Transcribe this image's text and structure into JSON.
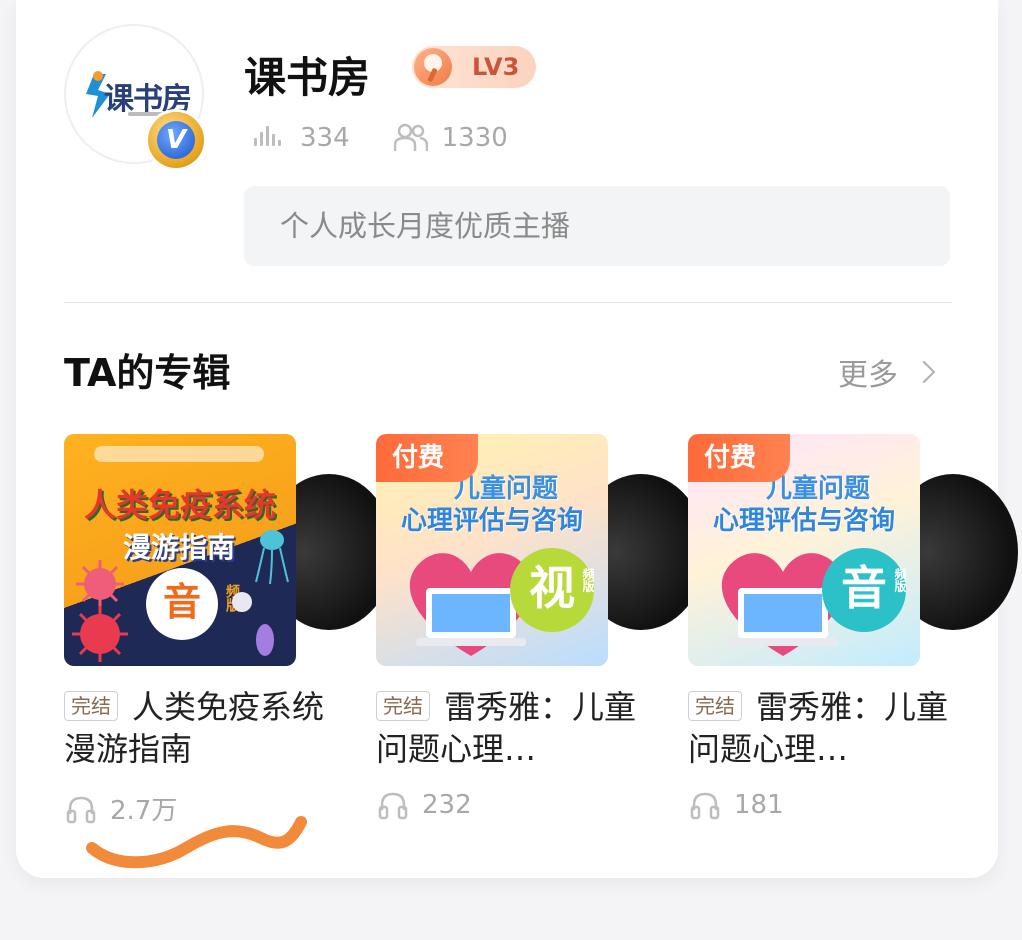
{
  "profile": {
    "avatar_logo_text": "课书房",
    "verified_icon": "v-badge-icon",
    "name": "课书房",
    "level": "LV3",
    "tracks_count": "334",
    "fans_count": "1330",
    "intro": "个人成长月度优质主播"
  },
  "albums_section": {
    "title": "TA的专辑",
    "more_label": "更多"
  },
  "albums": [
    {
      "paid": false,
      "cover_title_line1": "人类免疫系统",
      "cover_title_line2": "漫游指南",
      "cover_badge": "音",
      "cover_badge_small": "频版",
      "status": "完结",
      "title": "人类免疫系统漫游指南",
      "plays": "2.7万",
      "cover_colors": [
        "#f7a21b",
        "#1e2a55"
      ]
    },
    {
      "paid": true,
      "paid_label": "付费",
      "cover_title_line1": "儿童问题",
      "cover_title_line2": "心理评估与咨询",
      "cover_badge": "视",
      "cover_badge_small": "频版",
      "status": "完结",
      "title": "雷秀雅：儿童问题心理…",
      "plays": "232",
      "cover_colors": [
        "#fff1a8",
        "#a6d7ff"
      ]
    },
    {
      "paid": true,
      "paid_label": "付费",
      "cover_title_line1": "儿童问题",
      "cover_title_line2": "心理评估与咨询",
      "cover_badge": "音",
      "cover_badge_small": "频版",
      "status": "完结",
      "title": "雷秀雅：儿童问题心理…",
      "plays": "181",
      "cover_colors": [
        "#ffe7ff",
        "#b8e8ff"
      ]
    }
  ],
  "colors": {
    "accent_orange": "#ff6a3a",
    "lv_text": "#c8553a",
    "annotation_squiggle": "#f28a3b"
  }
}
